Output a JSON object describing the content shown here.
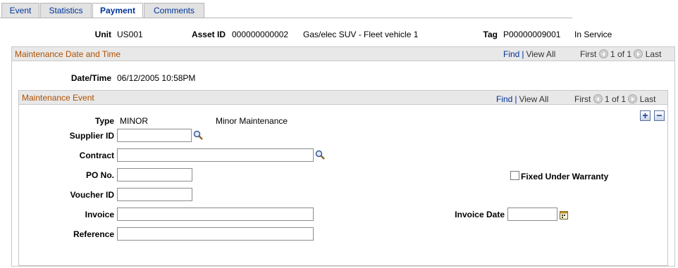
{
  "tabs": [
    {
      "label": "Event"
    },
    {
      "label": "Statistics"
    },
    {
      "label": "Payment"
    },
    {
      "label": "Comments"
    }
  ],
  "header": {
    "unit_label": "Unit",
    "unit_value": "US001",
    "asset_label": "Asset ID",
    "asset_value": "000000000002",
    "asset_desc": "Gas/elec SUV - Fleet vehicle 1",
    "tag_label": "Tag",
    "tag_value": "P00000009001",
    "status": "In Service"
  },
  "maint_date": {
    "title": "Maintenance Date and Time",
    "find": "Find",
    "view_all": "View All",
    "first": "First",
    "count": "1 of 1",
    "last": "Last",
    "datetime_label": "Date/Time",
    "datetime_value": "06/12/2005 10:58PM"
  },
  "maint_event": {
    "title": "Maintenance Event",
    "find": "Find",
    "view_all": "View All",
    "first": "First",
    "count": "1 of 1",
    "last": "Last",
    "add_symbol": "+",
    "delete_symbol": "−",
    "type_label": "Type",
    "type_value": "MINOR",
    "type_desc": "Minor Maintenance",
    "supplier_label": "Supplier ID",
    "supplier_value": "",
    "contract_label": "Contract",
    "contract_value": "",
    "po_label": "PO No.",
    "po_value": "",
    "warranty_label": "Fixed Under Warranty",
    "voucher_label": "Voucher ID",
    "voucher_value": "",
    "invoice_label": "Invoice",
    "invoice_value": "",
    "invoice_date_label": "Invoice Date",
    "invoice_date_value": "",
    "reference_label": "Reference",
    "reference_value": ""
  },
  "colors": {
    "link": "#003399",
    "group_title": "#b05000",
    "group_header_bg": "#e8e8e8",
    "tab_bg": "#e2e2e2"
  },
  "icons": [
    "lookup-icon",
    "calendar-icon",
    "prev-circle-icon",
    "next-circle-icon",
    "add-row-icon",
    "delete-row-icon"
  ]
}
